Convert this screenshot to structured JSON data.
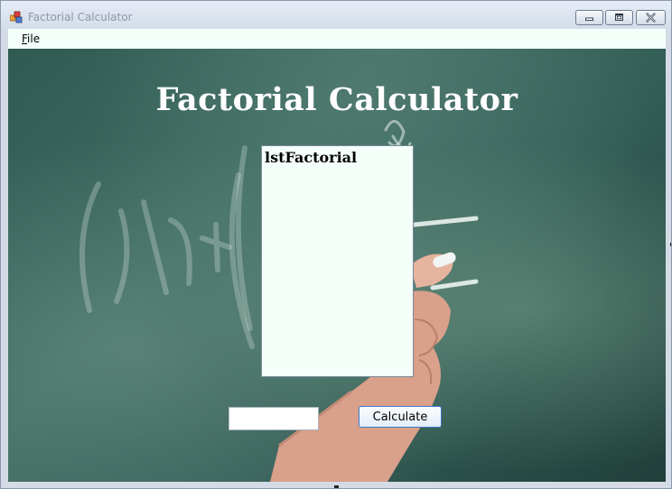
{
  "window": {
    "title": "Factorial Calculator"
  },
  "menu": {
    "file_label_underlined": "F",
    "file_label_rest": "ile"
  },
  "main": {
    "heading": "Factorial Calculator",
    "listbox": {
      "items": [
        "lstFactorial"
      ]
    },
    "number_input": {
      "value": ""
    },
    "calculate_button": {
      "label": "Calculate"
    }
  },
  "colors": {
    "chalkboard": "#3f6d63",
    "listbox_bg": "#f4fffa",
    "menubar_bg": "#f4fffa",
    "title_text": "#8d97a6",
    "button_border": "#3b79c8"
  },
  "icons": {
    "app": "winforms-app-icon",
    "minimize": "minimize-icon",
    "maximize": "maximize-icon",
    "close": "close-icon"
  }
}
